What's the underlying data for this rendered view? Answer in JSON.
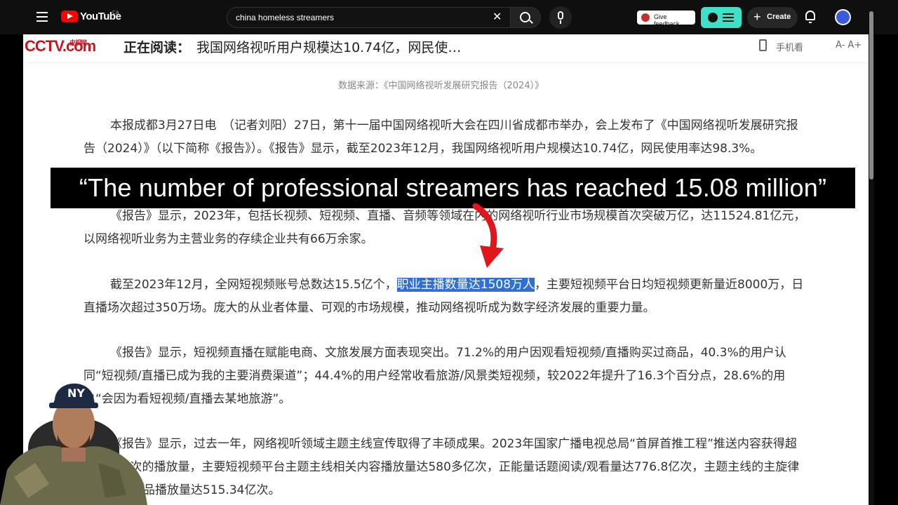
{
  "youtube": {
    "logo_text": "YouTube",
    "country_code": "CA",
    "search_query": "china homeless streamers",
    "feedback_label": "Give feedback",
    "create_label": "Create"
  },
  "article": {
    "site_logo": "CCTV.com",
    "site_logo_cn": "央视网",
    "reading_label": "正在阅读：",
    "reading_title": "我国网络视听用户规模达10.74亿，网民使…",
    "mobile_label": "手机看",
    "font_size_label": "A-  A+",
    "source_line": "数据来源：《中国网络视听发展研究报告（2024）》",
    "p1": "本报成都3月27日电　（记者刘阳）27日，第十一届中国网络视听大会在四川省成都市举办，会上发布了《中国网络视听发展研究报告（2024）》（以下简称《报告》）。《报告》显示，截至2023年12月，我国网络视听用户规模达10.74亿，网民使用率达98.3%。",
    "p2": "《报告》显示，2023年，包括长视频、短视频、直播、音频等领域在内的网络视听行业市场规模首次突破万亿，达11524.81亿元，以网络视听业务为主营业务的存续企业共有66万余家。",
    "p3_before": "截至2023年12月，全网短视频账号总数达15.5亿个，",
    "p3_highlight": "职业主播数量达1508万人",
    "p3_after": "，主要短视频平台日均短视频更新量近8000万，日直播场次超过350万场。庞大的从业者体量、可观的市场规模，推动网络视听成为数字经济发展的重要力量。",
    "p4": "《报告》显示，短视频直播在赋能电商、文旅发展方面表现突出。71.2%的用户因观看短视频/直播购买过商品，40.3%的用户认同“短视频/直播已成为我的主要消费渠道”；44.4%的用户经常收看旅游/风景类短视频，较2022年提升了16.3个百分点，28.6%的用户“会因为看短视频/直播去某地旅游”。",
    "p5": "《报告》显示，过去一年，网络视听领域主题主线宣传取得了丰硕成果。2023年国家广播电视总局“首屏首推工程”推送内容获得超过202亿次的播放量，主要短视频平台主题主线相关内容播放量达580多亿次，正能量话题阅读/观看量达776.8亿次，主题主线的主旋律类长视频作品播放量达515.34亿次。"
  },
  "caption": "“The number of professional streamers has reached 15.08 million”",
  "colors": {
    "highlight": "#2f6fd6",
    "arrow": "#e0161b",
    "accent": "#3ee0c8"
  }
}
